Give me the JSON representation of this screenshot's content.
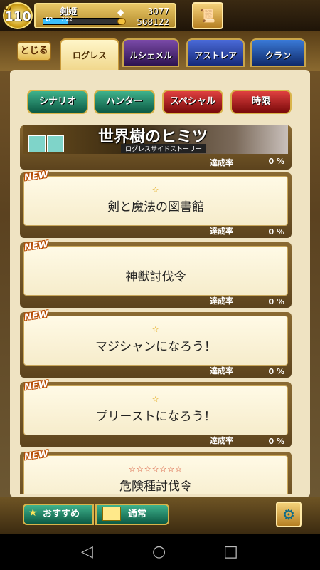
{
  "player": {
    "level_label": "Lv",
    "level": "110",
    "name": "剣姫",
    "exp_label": "EP",
    "exp_value": "7/22",
    "exp_fraction": 0.32,
    "crystal": "3077",
    "gold": "568122"
  },
  "nav": {
    "back_label": "とじる",
    "tabs": [
      "ログレス",
      "ルシェメル",
      "アストレア",
      "クラン"
    ]
  },
  "subtabs": [
    "シナリオ",
    "ハンター",
    "スペシャル",
    "時限"
  ],
  "banner": {
    "title": "世界樹のヒミツ",
    "subtitle": "ログレスサイドストーリー",
    "rate_label": "達成率",
    "rate_value": "0 %"
  },
  "quests": [
    {
      "new": "NEW",
      "stars": "☆",
      "title": "剣と魔法の図書館",
      "rate_label": "達成率",
      "rate_value": "0 %"
    },
    {
      "new": "NEW",
      "stars": "",
      "title": "神獣討伐令",
      "rate_label": "達成率",
      "rate_value": "0 %"
    },
    {
      "new": "NEW",
      "stars": "☆",
      "title": "マジシャンになろう！",
      "rate_label": "達成率",
      "rate_value": "0 %"
    },
    {
      "new": "NEW",
      "stars": "☆",
      "title": "プリーストになろう！",
      "rate_label": "達成率",
      "rate_value": "0 %"
    },
    {
      "new": "NEW",
      "stars": "☆☆☆☆☆☆☆",
      "title": "危険種討伐令",
      "rate_label": "",
      "rate_value": ""
    }
  ],
  "bottom": {
    "recommend_label": "おすすめ",
    "normal_label": "通常"
  },
  "colors": {
    "accent_green": "#3fb28c",
    "accent_red": "#e04040",
    "gold": "#d9b44a"
  },
  "icons": {
    "menu": "scroll-book-icon",
    "settings": "gear-icon",
    "nav_back": "triangle-back-icon",
    "nav_home": "circle-home-icon",
    "nav_recent": "square-recent-icon"
  }
}
